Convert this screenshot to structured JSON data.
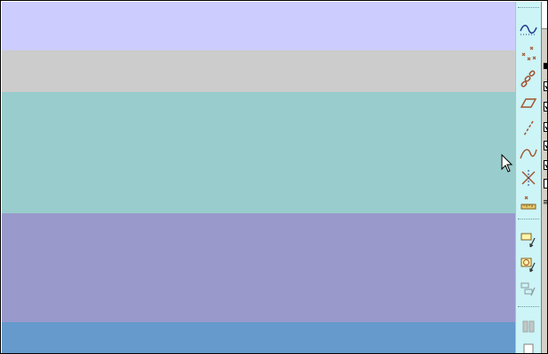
{
  "colors": {
    "band_1": "#ccccfe",
    "band_2": "#cccccc",
    "band_3": "#99cccc",
    "band_4": "#9999cc",
    "band_5": "#6699cc",
    "toolbar_bg": "#cdf4f6",
    "icon_stroke": "#a0522d",
    "icon_blue": "#1e3c8c"
  },
  "toolbar": {
    "tools": [
      {
        "icon": "curve-wave-icon"
      },
      {
        "icon": "scatter-points-icon"
      },
      {
        "icon": "chain-link-icon"
      },
      {
        "icon": "parallelogram-icon"
      },
      {
        "icon": "dashed-line-icon"
      },
      {
        "icon": "spline-icon"
      },
      {
        "icon": "intersection-icon"
      },
      {
        "icon": "measure-ruler-icon"
      }
    ],
    "tools2": [
      {
        "icon": "rect-to-point-icon"
      },
      {
        "icon": "circle-rect-icon"
      },
      {
        "icon": "layers-icon"
      }
    ],
    "tools3": [
      {
        "icon": "grid-disabled-icon"
      },
      {
        "icon": "page-icon"
      }
    ]
  },
  "side_panel": {
    "checkbox_states": [
      true,
      true,
      true,
      true,
      true,
      true,
      false
    ]
  }
}
